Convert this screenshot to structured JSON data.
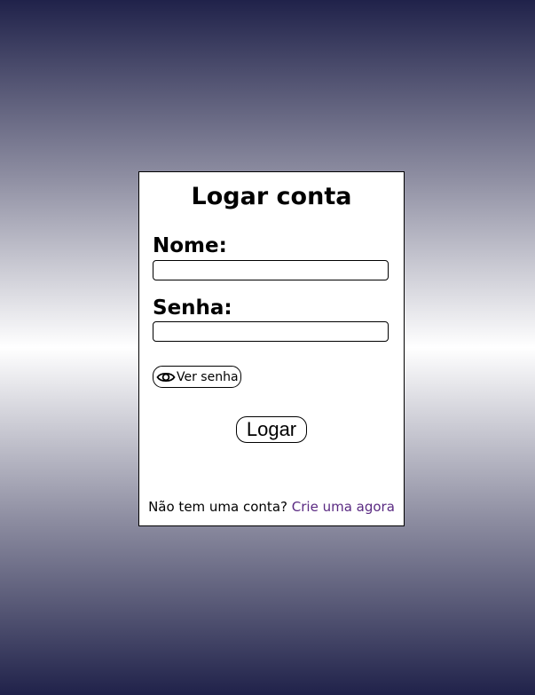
{
  "form": {
    "title": "Logar conta",
    "name_label": "Nome:",
    "name_value": "",
    "password_label": "Senha:",
    "password_value": "",
    "show_password_label": "Ver senha",
    "show_password_icon": "eye-icon",
    "submit_label": "Logar"
  },
  "footer": {
    "prompt": "Não tem uma conta?",
    "signup_link": "Crie uma agora"
  },
  "colors": {
    "background_dark": "#20224a",
    "background_light": "#ffffff",
    "link": "#5a2a82"
  }
}
